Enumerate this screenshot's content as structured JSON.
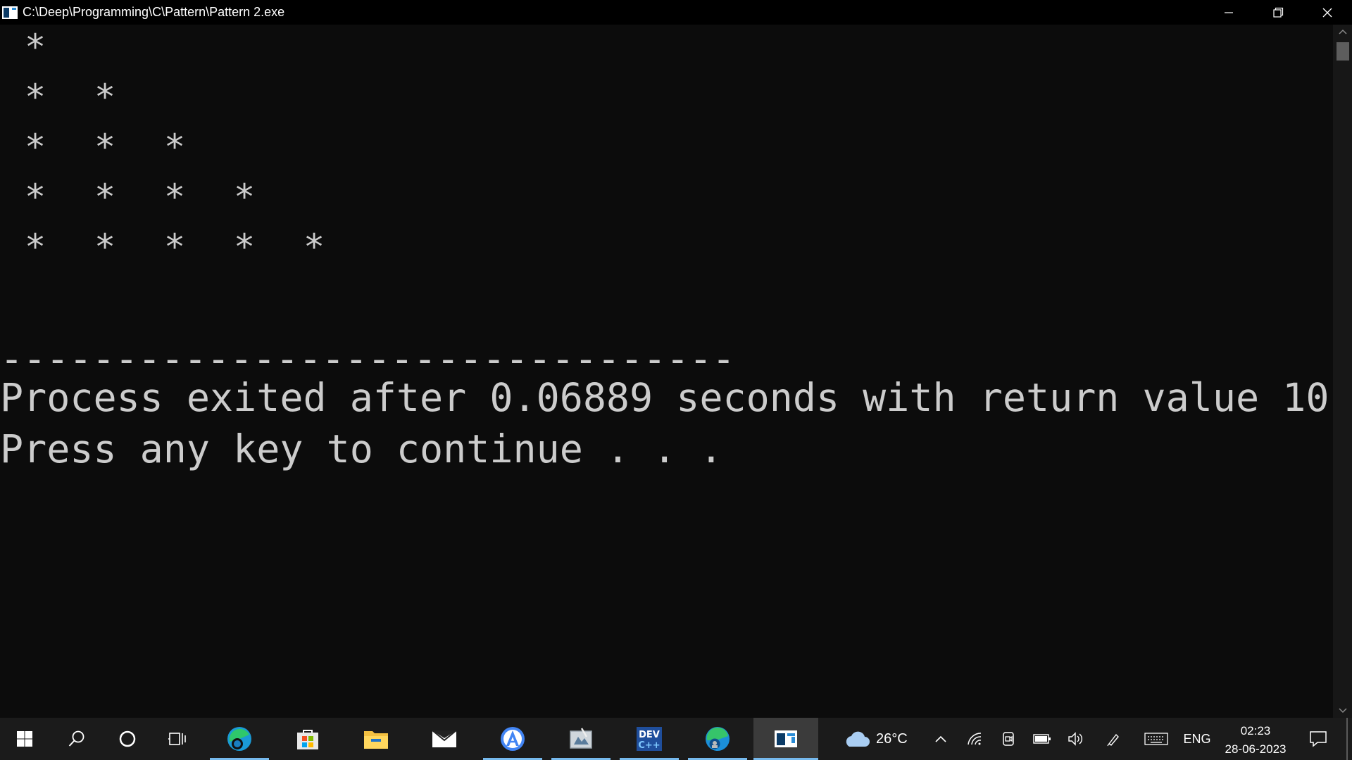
{
  "window": {
    "title": "C:\\Deep\\Programming\\C\\Pattern\\Pattern 2.exe",
    "controls": {
      "minimize_icon": "minimize-icon",
      "restore_icon": "restore-icon",
      "close_icon": "close-icon"
    }
  },
  "console": {
    "pattern_rows": [
      [
        "*"
      ],
      [
        "*",
        "*"
      ],
      [
        "*",
        "*",
        "*"
      ],
      [
        "*",
        "*",
        "*",
        "*"
      ],
      [
        "*",
        "*",
        "*",
        "*",
        "*"
      ]
    ],
    "separator": "--------------------------------",
    "output_line_1": "Process exited after 0.06889 seconds with return value 10",
    "output_line_2": "Press any key to continue . . ."
  },
  "taskbar": {
    "start_icon": "windows-start-icon",
    "search_icon": "search-icon",
    "cortana_icon": "cortana-icon",
    "task_view_icon": "task-view-icon",
    "apps": [
      {
        "name": "Microsoft Edge Beta",
        "icon": "edge-beta-icon",
        "running": true
      },
      {
        "name": "Microsoft Store",
        "icon": "store-icon",
        "running": false
      },
      {
        "name": "File Explorer",
        "icon": "file-explorer-icon",
        "running": false
      },
      {
        "name": "Mail",
        "icon": "mail-icon",
        "running": false
      },
      {
        "name": "Android Studio",
        "icon": "android-studio-icon",
        "running": true
      },
      {
        "name": "Snipping Tool",
        "icon": "snipping-tool-icon",
        "running": true
      },
      {
        "name": "Dev-C++",
        "icon": "dev-cpp-icon",
        "running": true
      },
      {
        "name": "Microsoft Edge",
        "icon": "edge-icon",
        "running": true
      },
      {
        "name": "Console Window",
        "icon": "console-icon",
        "running": true,
        "active": true
      }
    ],
    "weather": {
      "icon": "cloud-icon",
      "temperature": "26°C"
    },
    "tray": {
      "chevron_icon": "chevron-up-icon",
      "network_icon": "wifi-icon",
      "meet_icon": "meet-now-icon",
      "battery_icon": "battery-icon",
      "volume_icon": "volume-icon",
      "pen_icon": "pen-icon",
      "keyboard_icon": "touch-keyboard-icon",
      "language": "ENG"
    },
    "clock": {
      "time": "02:23",
      "date": "28-06-2023"
    },
    "notification_icon": "notification-icon"
  },
  "colors": {
    "console_bg": "#0c0c0c",
    "console_text": "#cccccc",
    "titlebar_bg": "#000000",
    "taskbar_bg": "#1b1b1b",
    "running_indicator": "#76b9ed"
  }
}
